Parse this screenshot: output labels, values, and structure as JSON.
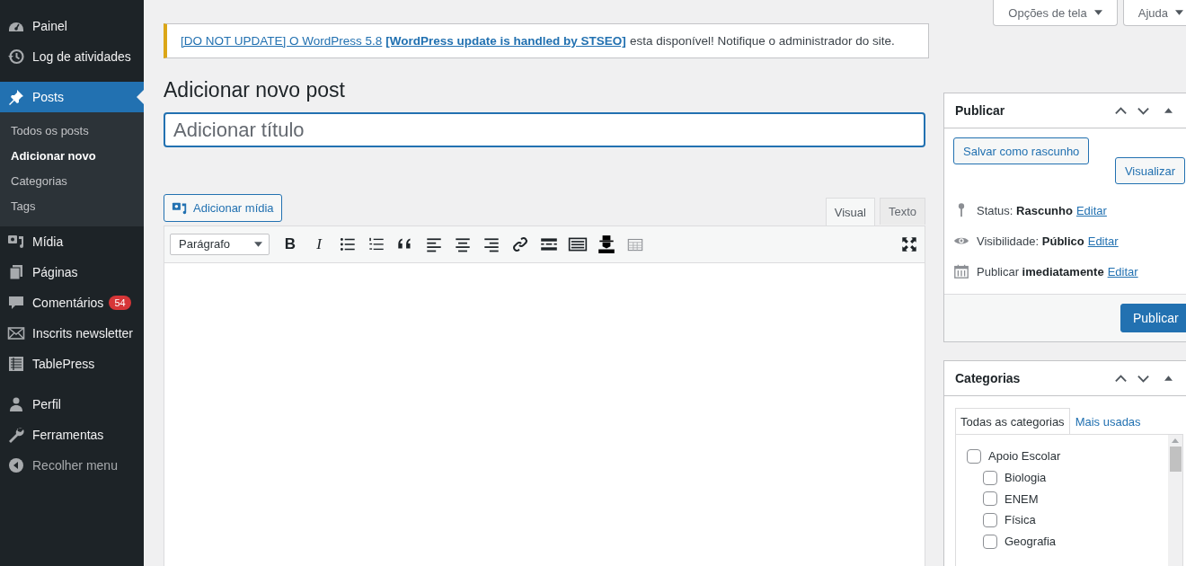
{
  "sidebar": {
    "items": [
      {
        "label": "Painel",
        "selected": false
      },
      {
        "label": "Log de atividades",
        "selected": false
      },
      {
        "label": "Posts",
        "selected": true,
        "children": [
          {
            "label": "Todos os posts",
            "selected": false
          },
          {
            "label": "Adicionar novo",
            "selected": true
          },
          {
            "label": "Categorias",
            "selected": false
          },
          {
            "label": "Tags",
            "selected": false
          }
        ]
      },
      {
        "label": "Mídia",
        "selected": false
      },
      {
        "label": "Páginas",
        "selected": false
      },
      {
        "label": "Comentários",
        "selected": false,
        "badge": "54"
      },
      {
        "label": "Inscrits newsletter",
        "selected": false
      },
      {
        "label": "TablePress",
        "selected": false
      },
      {
        "label": "Perfil",
        "selected": false
      },
      {
        "label": "Ferramentas",
        "selected": false
      },
      {
        "label": "Recolher menu",
        "selected": false
      }
    ]
  },
  "top_buttons": [
    "Opções de tela",
    "Ajuda"
  ],
  "notice": {
    "link": "[DO NOT UPDATE] O WordPress 5.8",
    "bold_link": "[WordPress update is handled by STSEO]",
    "text": "esta disponível! Notifique o administrador do site."
  },
  "heading": "Adicionar novo post",
  "title_field": {
    "placeholder": "Adicionar título"
  },
  "editor": {
    "media_button": "Adicionar mídia",
    "tabs": [
      {
        "label": "Visual",
        "selected": true
      },
      {
        "label": "Texto",
        "selected": false
      }
    ],
    "format_select": "Parágrafo",
    "glyphs": [
      "B",
      "I"
    ]
  },
  "publish_box": {
    "title": "Publicar",
    "save_draft": "Salvar como rascunho",
    "preview": "Visualizar",
    "meta": [
      {
        "text": "Status: **Rascunho**",
        "link": "Editar"
      },
      {
        "text": "Visibilidade: **Público**",
        "link": "Editar"
      },
      {
        "text": "Publicar **imediatamente**",
        "link": "Editar"
      }
    ],
    "publish": "Publicar"
  },
  "categories_box": {
    "title": "Categorias",
    "tabs": [
      {
        "label": "Todas as categorias",
        "selected": true
      },
      {
        "label": "Mais usadas",
        "selected": false
      }
    ],
    "items": [
      {
        "label": "Apoio Escolar",
        "checked": false,
        "children": [
          {
            "label": "Biologia",
            "checked": false
          },
          {
            "label": "ENEM",
            "checked": false
          },
          {
            "label": "Física",
            "checked": false
          },
          {
            "label": "Geografia",
            "checked": false
          }
        ]
      }
    ]
  }
}
